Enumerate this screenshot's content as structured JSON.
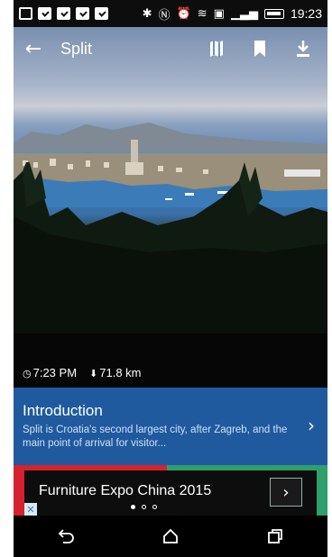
{
  "status_bar": {
    "time": "19:23",
    "icons": [
      "notification-icon",
      "notification-icon",
      "notification-icon",
      "notification-icon",
      "notification-icon",
      "bluetooth-icon",
      "nfc-icon",
      "alarm-icon",
      "wifi-icon",
      "cast-icon",
      "signal-icon",
      "battery-icon"
    ]
  },
  "app_bar": {
    "title": "Split",
    "actions": [
      "map-icon",
      "bookmark-icon",
      "download-icon"
    ]
  },
  "hero": {
    "time_label": "7:23 PM",
    "distance_label": "71.8 km"
  },
  "intro": {
    "title": "Introduction",
    "text": "Split is Croatia's second largest city, after Zagreb, and the main point of arrival for visitor..."
  },
  "ad": {
    "text": "Furniture Expo China 2015",
    "pager": {
      "count": 3,
      "active": 0
    },
    "colors": {
      "left": "#d6222e",
      "right": "#2f9f6c"
    }
  },
  "nav_bar": {
    "buttons": [
      "back-nav-icon",
      "home-icon",
      "recents-icon"
    ]
  },
  "colors": {
    "accent": "#1f5a9e"
  }
}
